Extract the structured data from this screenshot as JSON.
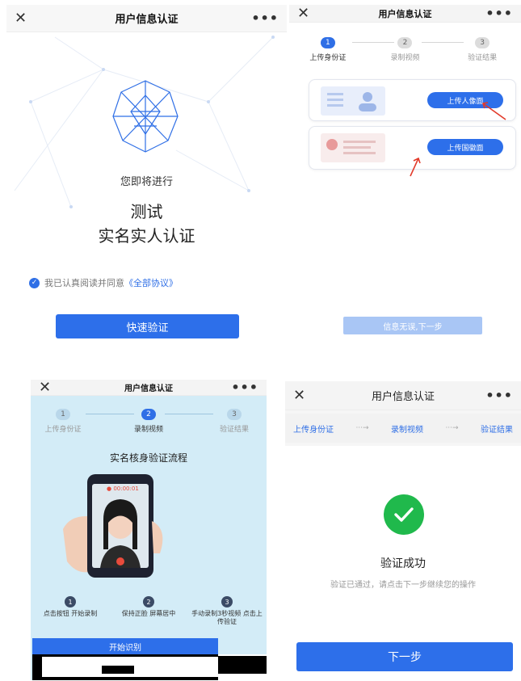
{
  "common": {
    "title": "用户信息认证",
    "close": "✕",
    "more": "•••"
  },
  "panel1": {
    "subtitle": "您即将进行",
    "line1": "测试",
    "line2": "实名实人认证",
    "agree_text": "我已认真阅读并同意",
    "agree_link": "《全部协议》",
    "agree_checked": true,
    "button": "快速验证"
  },
  "steps": {
    "s1": {
      "num": "1",
      "label": "上传身份证"
    },
    "s2": {
      "num": "2",
      "label": "录制视频"
    },
    "s3": {
      "num": "3",
      "label": "验证结果"
    }
  },
  "panel2": {
    "active_step": 1,
    "upload_portrait": "上传人像面",
    "upload_emblem": "上传国徽面",
    "next": "信息无误,下一步"
  },
  "panel3": {
    "active_step": 2,
    "heading": "实名核身验证流程",
    "timer": "● 00:00:01",
    "how": [
      {
        "num": "1",
        "text": "点击按钮 开始录制"
      },
      {
        "num": "2",
        "text": "保持正脸 屏幕居中"
      },
      {
        "num": "3",
        "text": "手动录制3秒视频 点击上传验证"
      }
    ],
    "start": "开始识别"
  },
  "panel4": {
    "crumb1": "上传身份证",
    "crumb2": "录制视频",
    "crumb3": "验证结果",
    "crumb_arrow": "···→",
    "status_title": "验证成功",
    "status_desc": "验证已通过，请点击下一步继续您的操作",
    "next": "下一步"
  },
  "colors": {
    "primary": "#2d6fea",
    "success": "#20b94c",
    "disabled": "#a9c6f5"
  }
}
